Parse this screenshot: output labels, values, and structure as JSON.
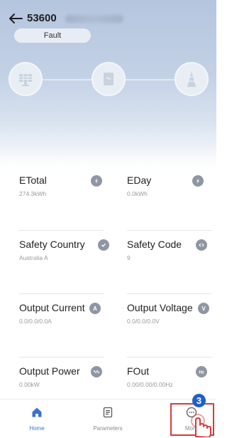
{
  "header": {
    "device_sn": "53600",
    "status": "Fault"
  },
  "flow_nodes": [
    {
      "icon": "solar-panel-icon"
    },
    {
      "icon": "inverter-icon"
    },
    {
      "icon": "power-tower-icon"
    }
  ],
  "metrics": [
    {
      "label": "ETotal",
      "value": "274.3kWh",
      "icon": "energy-total-icon"
    },
    {
      "label": "EDay",
      "value": "0.0kWh",
      "icon": "energy-day-icon"
    },
    {
      "label": "Safety Country",
      "value": "Australia A",
      "icon": "shield-check-icon"
    },
    {
      "label": "Safety Code",
      "value": "9",
      "icon": "code-shield-icon"
    },
    {
      "label": "Output Current",
      "value": "0.0/0.0/0.0A",
      "icon": "current-icon"
    },
    {
      "label": "Output Voltage",
      "value": "0.0/0.0/0.0V",
      "icon": "voltage-icon"
    },
    {
      "label": "Output Power",
      "value": "0.00kW",
      "icon": "power-icon"
    },
    {
      "label": "FOut",
      "value": "0.00/0.00/0.00Hz",
      "icon": "frequency-icon"
    }
  ],
  "tabs": [
    {
      "label": "Home",
      "icon": "home-icon"
    },
    {
      "label": "Parameters",
      "icon": "parameters-icon"
    },
    {
      "label": "More",
      "icon": "more-icon"
    }
  ],
  "step_badge": "3",
  "colors": {
    "accent": "#3d73c8",
    "highlight": "#d83a3a",
    "badge": "#1d5fc9"
  }
}
